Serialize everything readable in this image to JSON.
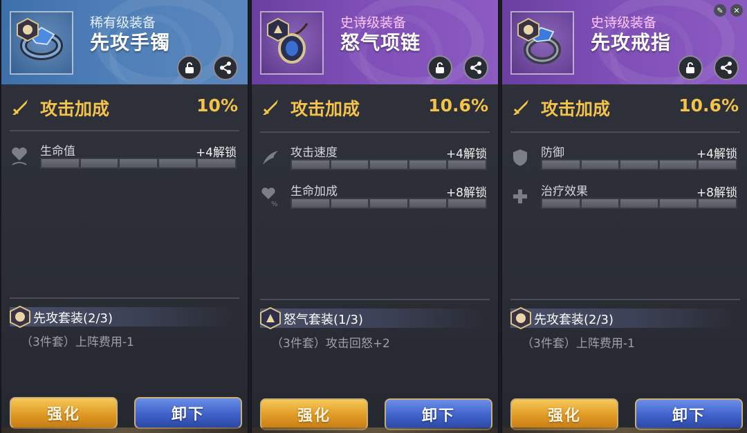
{
  "colors": {
    "rare_header": "#4f7fb8",
    "epic_header": "#7f4fb7",
    "main_stat": "#f3c34a",
    "enhance_button": "#e09a23",
    "unequip_button": "#3f61c9"
  },
  "cards": [
    {
      "rarity": "稀有级装备",
      "name": "先攻手镯",
      "item_icon": "bracelet-icon",
      "main_stat": {
        "label": "攻击加成",
        "value": "10%"
      },
      "sub_stats": [
        {
          "label": "生命值",
          "unlock": "+4解锁",
          "icon": "heart-icon"
        }
      ],
      "set": {
        "name": "先攻套装(2/3)",
        "effect": "（3件套）上阵费用-1"
      },
      "buttons": {
        "enhance": "强化",
        "unequip": "卸下"
      }
    },
    {
      "rarity": "史诗级装备",
      "name": "怒气项链",
      "item_icon": "necklace-icon",
      "main_stat": {
        "label": "攻击加成",
        "value": "10.6%"
      },
      "sub_stats": [
        {
          "label": "攻击速度",
          "unlock": "+4解锁",
          "icon": "wing-icon"
        },
        {
          "label": "生命加成",
          "unlock": "+8解锁",
          "icon": "heart-plus-icon"
        }
      ],
      "set": {
        "name": "怒气套装(1/3)",
        "effect": "（3件套）攻击回怒+2"
      },
      "buttons": {
        "enhance": "强化",
        "unequip": "卸下"
      }
    },
    {
      "rarity": "史诗级装备",
      "name": "先攻戒指",
      "item_icon": "ring-icon",
      "main_stat": {
        "label": "攻击加成",
        "value": "10.6%"
      },
      "sub_stats": [
        {
          "label": "防御",
          "unlock": "+4解锁",
          "icon": "shield-icon"
        },
        {
          "label": "治疗效果",
          "unlock": "+8解锁",
          "icon": "heal-icon"
        }
      ],
      "set": {
        "name": "先攻套装(2/3)",
        "effect": "（3件套）上阵费用-1"
      },
      "buttons": {
        "enhance": "强化",
        "unequip": "卸下"
      }
    }
  ]
}
